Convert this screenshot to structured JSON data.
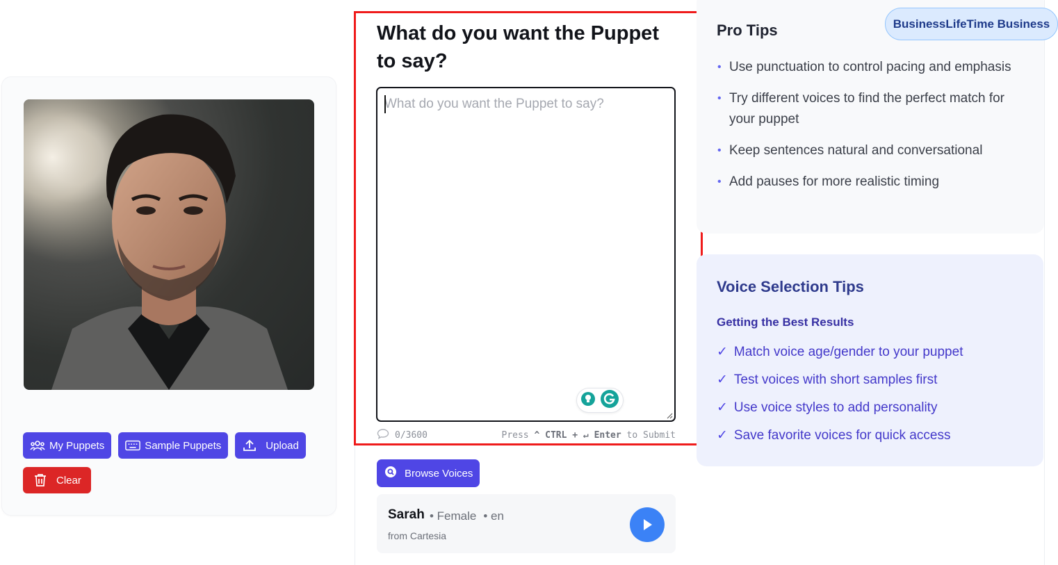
{
  "left_panel": {
    "buttons": {
      "my_puppets": "My Puppets",
      "sample_puppets": "Sample Puppets",
      "upload": "Upload",
      "clear": "Clear"
    }
  },
  "editor": {
    "title": "What do you want the Puppet to say?",
    "placeholder": "What do you want the Puppet to say?",
    "value": "",
    "char_count": "0/3600",
    "submit_hint": {
      "press": "Press",
      "key1": "^ CTRL",
      "plus": "+",
      "key2": "↵ Enter",
      "suffix": "to Submit"
    }
  },
  "voice": {
    "browse_label": "Browse Voices",
    "name": "Sarah",
    "gender": "• Female",
    "language": "•  en",
    "source": "from Cartesia"
  },
  "pro_tips": {
    "title": "Pro Tips",
    "items": [
      "Use punctuation to control pacing and emphasis",
      "Try different voices to find the perfect match for your puppet",
      "Keep sentences natural and conversational",
      "Add pauses for more realistic timing"
    ]
  },
  "badge": {
    "label": "BusinessLifeTime Business"
  },
  "voice_tips": {
    "title": "Voice Selection Tips",
    "subtitle": "Getting the Best Results",
    "items": [
      "Match voice age/gender to your puppet",
      "Test voices with short samples first",
      "Use voice styles to add personality",
      "Save favorite voices for quick access"
    ]
  },
  "colors": {
    "primary": "#4f46e5",
    "danger": "#dc2626",
    "play": "#3b82f6",
    "highlight": "#ef1b1b"
  }
}
